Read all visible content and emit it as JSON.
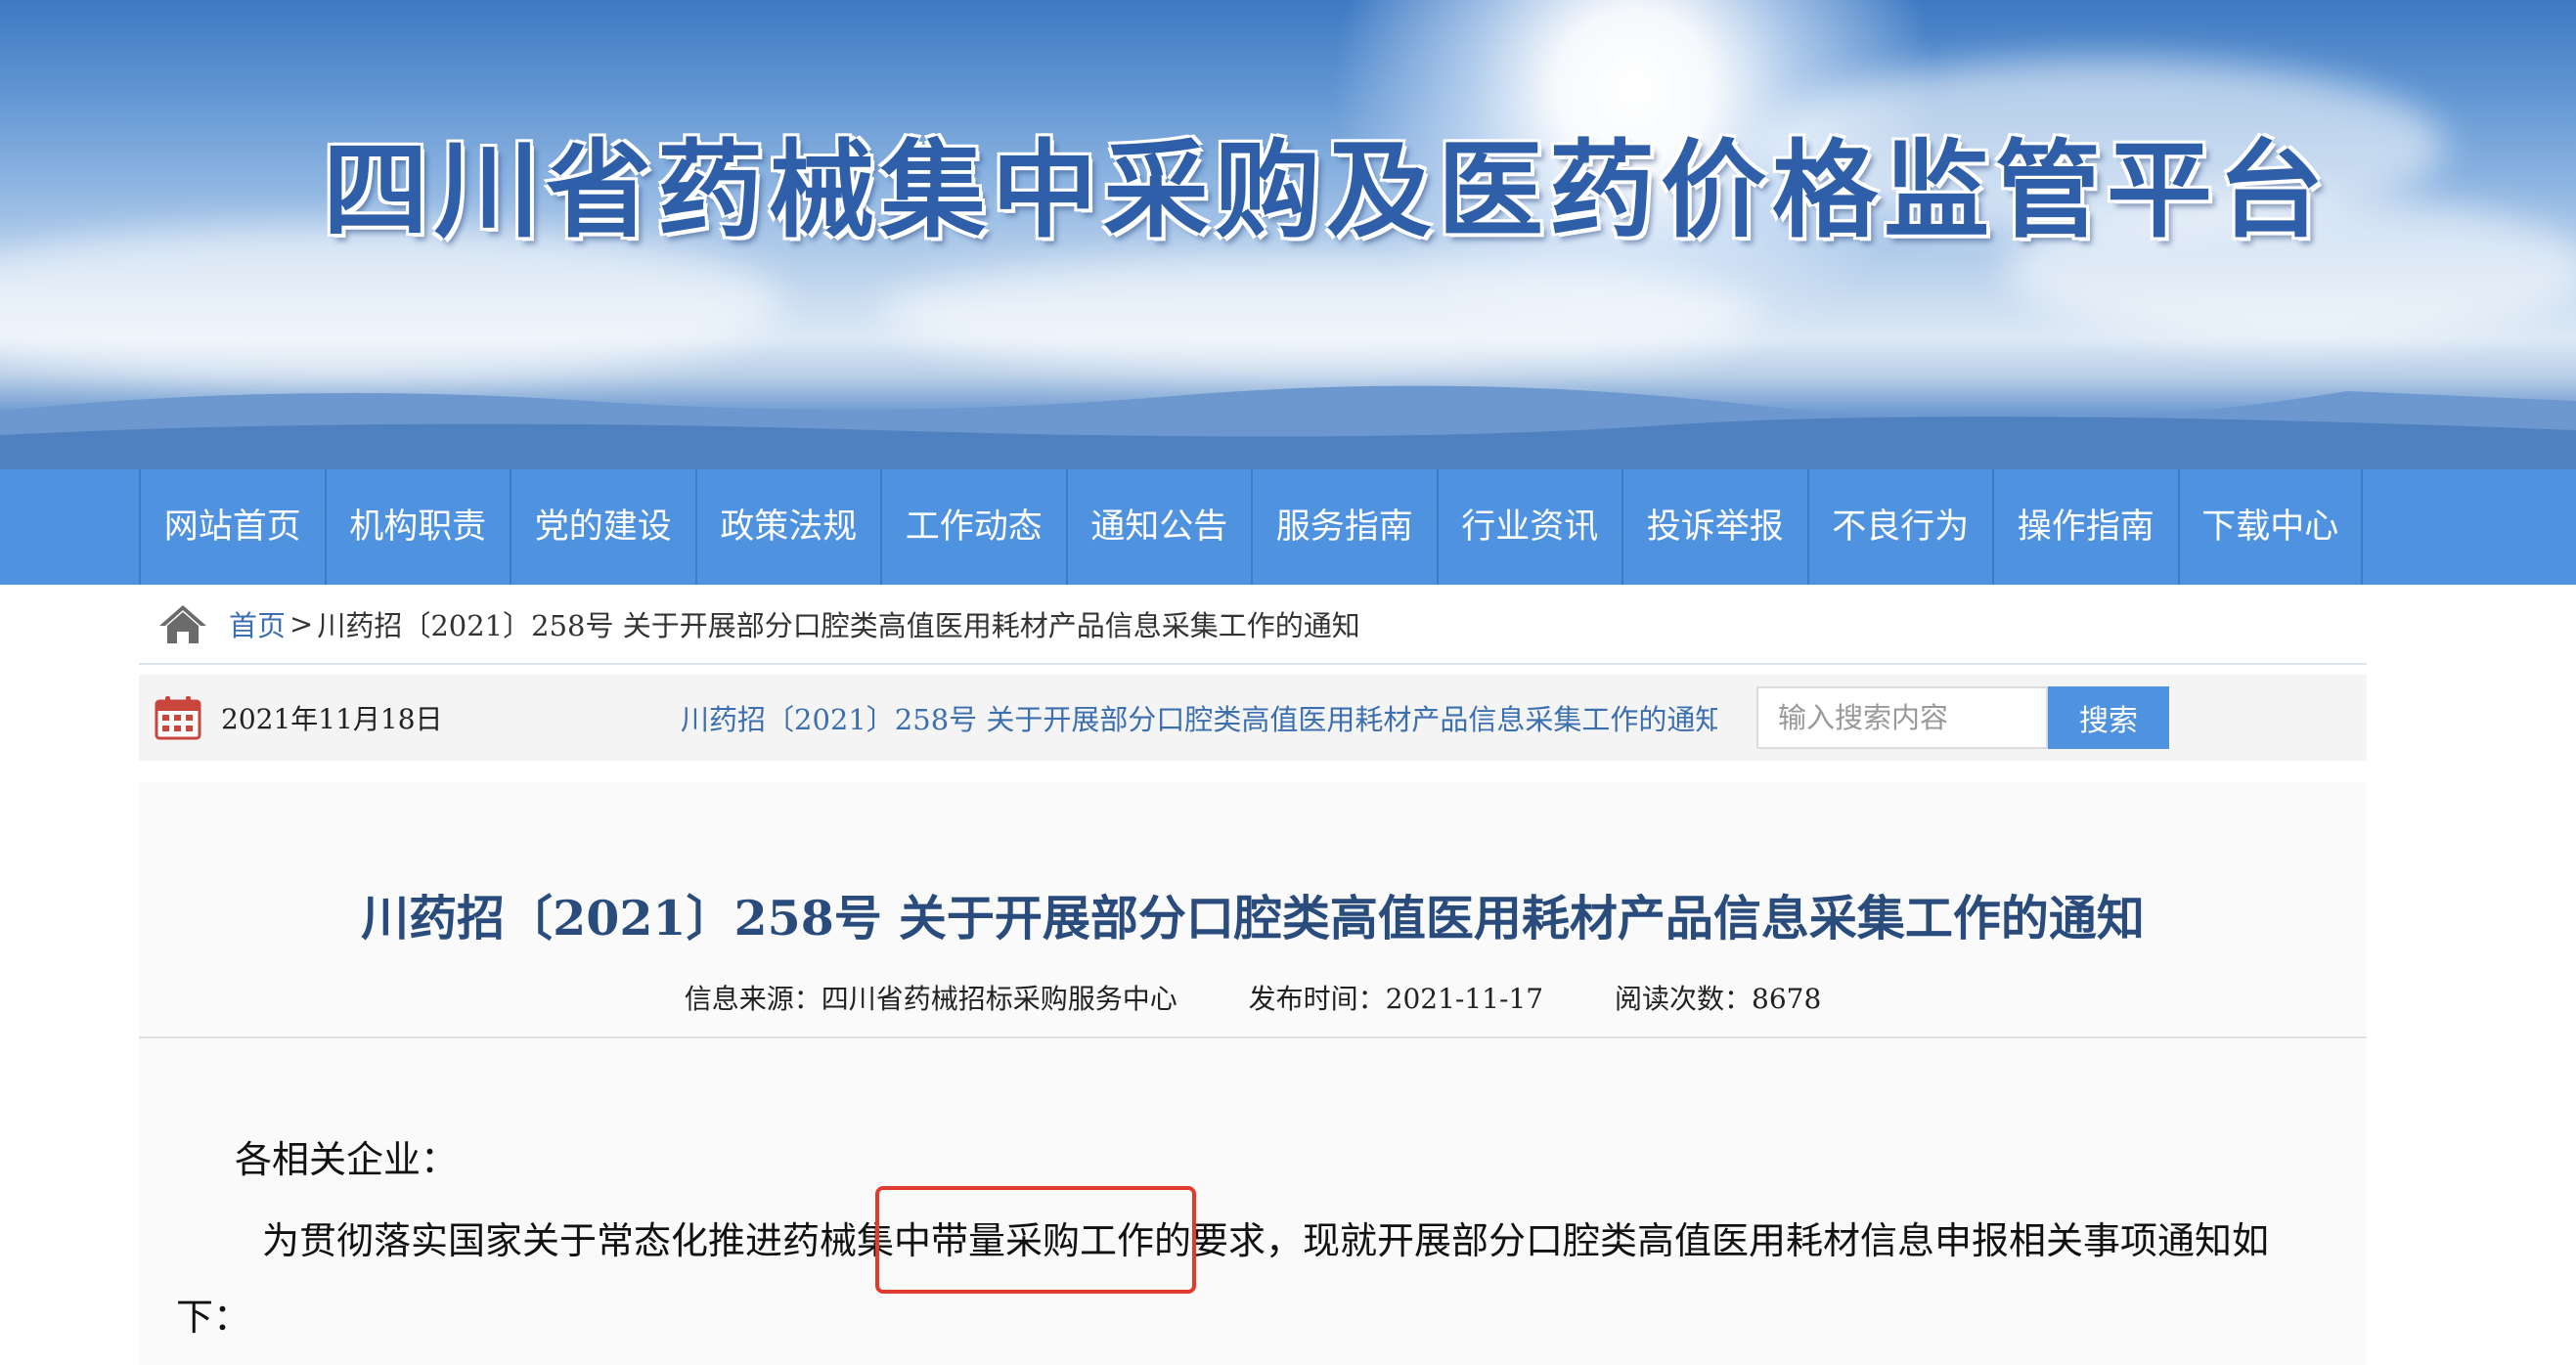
{
  "site": {
    "title": "四川省药械集中采购及医药价格监管平台"
  },
  "nav": {
    "items": [
      "网站首页",
      "机构职责",
      "党的建设",
      "政策法规",
      "工作动态",
      "通知公告",
      "服务指南",
      "行业资讯",
      "投诉举报",
      "不良行为",
      "操作指南",
      "下载中心"
    ]
  },
  "breadcrumb": {
    "home": "首页",
    "separator": ">",
    "current": "川药招〔2021〕258号 关于开展部分口腔类高值医用耗材产品信息采集工作的通知"
  },
  "info": {
    "date": "2021年11月18日",
    "marquee": "川药招〔2021〕258号 关于开展部分口腔类高值医用耗材产品信息采集工作的通知"
  },
  "search": {
    "placeholder": "输入搜索内容",
    "button": "搜索"
  },
  "article": {
    "title": "川药招〔2021〕258号 关于开展部分口腔类高值医用耗材产品信息采集工作的通知",
    "source": "信息来源：四川省药械招标采购服务中心",
    "published": "发布时间：2021-11-17",
    "reads": "阅读次数：8678",
    "greeting": "各相关企业：",
    "paragraph": "为贯彻落实国家关于常态化推进药械集中带量采购工作的要求，现就开展部分口腔类高值医用耗材信息申报相关事项通知如下："
  },
  "colors": {
    "nav_bg": "#4f92e0",
    "link": "#3c6fb0",
    "title": "#2a4c7d",
    "highlight_box": "#e23b2e"
  }
}
